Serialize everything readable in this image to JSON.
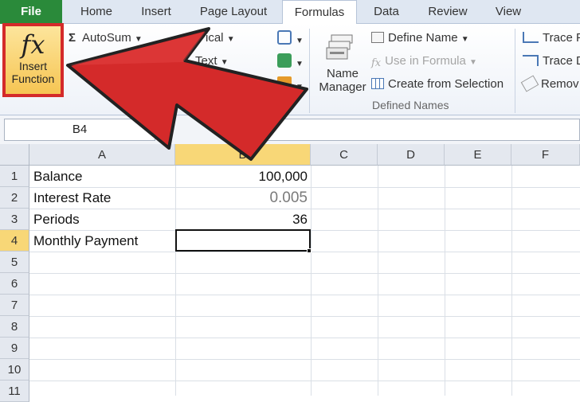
{
  "tabs": [
    "File",
    "Home",
    "Insert",
    "Page Layout",
    "Formulas",
    "Data",
    "Review",
    "View"
  ],
  "ribbon": {
    "insert_function": {
      "line1": "Insert",
      "line2": "Function",
      "icon": "fx"
    },
    "autosum": "AutoSum",
    "logical": "ical",
    "text": "Text",
    "datetime": "& Time",
    "name_manager": {
      "line1": "Name",
      "line2": "Manager"
    },
    "define_name": "Define Name",
    "use_in_formula": "Use in Formula",
    "create_from_selection": "Create from Selection",
    "defined_names_group": "Defined Names",
    "trace_precedents": "Trace P",
    "trace_dependents": "Trace D",
    "remove_arrows": "Remov"
  },
  "formula_bar": {
    "name_box": "B4",
    "fx": "fx",
    "value": ""
  },
  "columns": [
    "A",
    "B",
    "C",
    "D",
    "E",
    "F"
  ],
  "rows": [
    "1",
    "2",
    "3",
    "4",
    "5",
    "6",
    "7",
    "8",
    "9",
    "10",
    "11"
  ],
  "cells": {
    "A1": "Balance",
    "B1": "100,000",
    "A2": "Interest Rate",
    "B2": "0.005",
    "A3": "Periods",
    "B3": "36",
    "A4": "Monthly Payment"
  },
  "colors": {
    "file_tab": "#2a8a3a",
    "highlight": "#d42a2a",
    "selected_header": "#f8d777",
    "arrow": "#d42a2a"
  }
}
